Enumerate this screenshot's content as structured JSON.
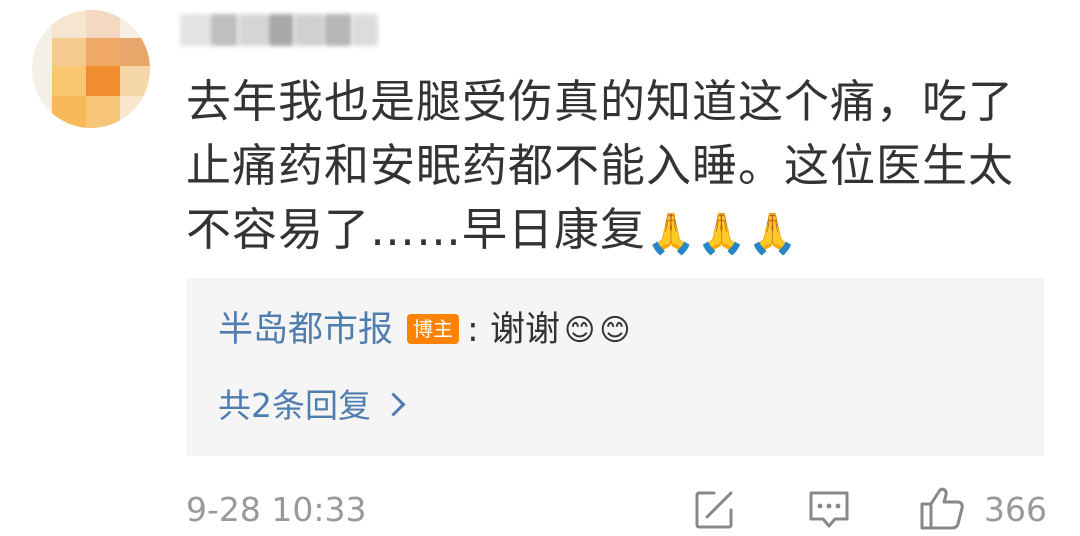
{
  "comment": {
    "username": "",
    "text": "去年我也是腿受伤真的知道这个痛，吃了止痛药和安眠药都不能入睡。这位医生太不容易了……早日康复",
    "emojis": [
      "🙏",
      "🙏",
      "🙏"
    ]
  },
  "reply": {
    "author": "半岛都市报",
    "badge": "博主",
    "separator": ":",
    "text": "谢谢",
    "emojis": [
      "😊",
      "😊"
    ],
    "more_replies": "共2条回复"
  },
  "footer": {
    "timestamp": "9-28 10:33",
    "like_count": "366"
  },
  "colors": {
    "link": "#507daf",
    "badge": "#ff8200",
    "meta": "#999999",
    "reply_bg": "#f5f5f5"
  },
  "icons": {
    "share": "edit-share-icon",
    "comment": "comment-icon",
    "like": "thumbs-up-icon",
    "chevron": "chevron-right-icon"
  }
}
